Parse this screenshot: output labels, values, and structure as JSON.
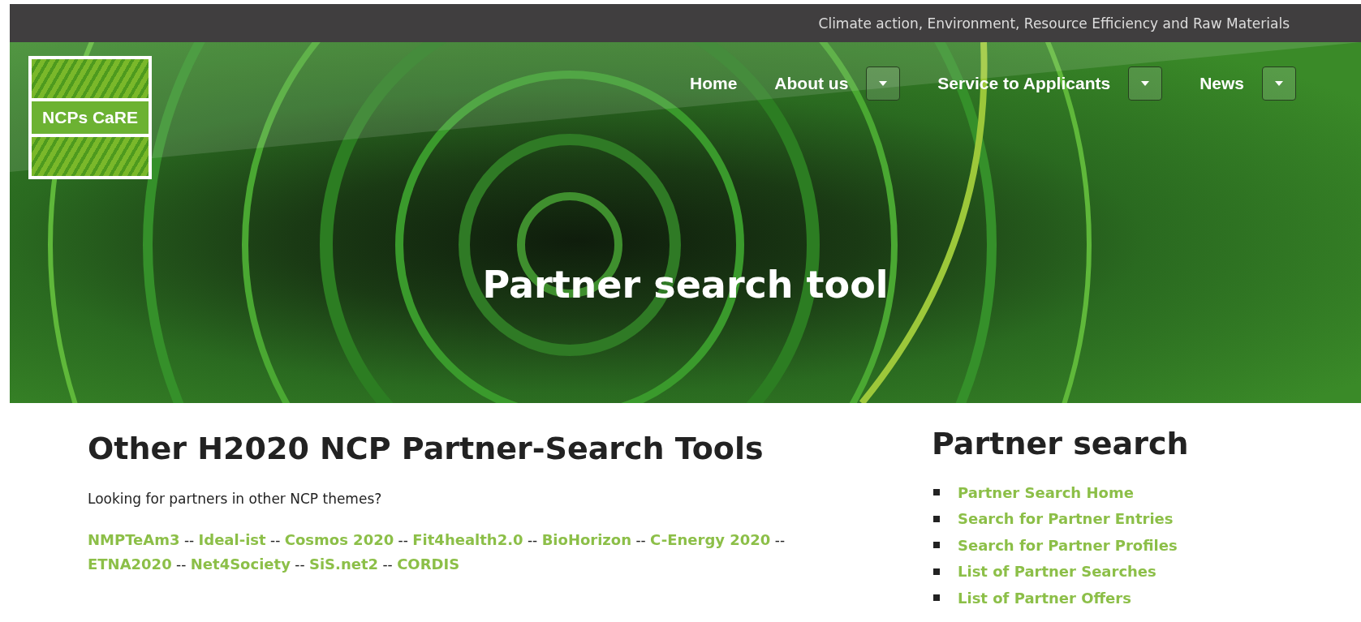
{
  "top_bar": {
    "tagline": "Climate action, Environment, Resource Efficiency and Raw Materials"
  },
  "logo": {
    "text": "NCPs CaRE"
  },
  "nav": [
    {
      "label": "Home",
      "dropdown": false
    },
    {
      "label": "About us",
      "dropdown": true
    },
    {
      "label": "Service to Applicants",
      "dropdown": true
    },
    {
      "label": "News",
      "dropdown": true
    }
  ],
  "hero": {
    "title": "Partner search tool"
  },
  "main": {
    "heading": "Other H2020 NCP Partner-Search Tools",
    "intro": "Looking for partners in other NCP themes?",
    "separator": "--",
    "link_lines": [
      [
        "NMPTeAm3",
        "Ideal-ist",
        "Cosmos 2020",
        "Fit4health2.0",
        "BioHorizon",
        "C-Energy 2020"
      ],
      [
        "ETNA2020",
        "Net4Society",
        "SiS.net2",
        "CORDIS"
      ]
    ]
  },
  "sidebar": {
    "heading": "Partner search",
    "items": [
      "Partner Search Home",
      "Search for Partner Entries",
      "Search for Partner Profiles",
      "List of Partner Searches",
      "List of Partner Offers"
    ]
  }
}
